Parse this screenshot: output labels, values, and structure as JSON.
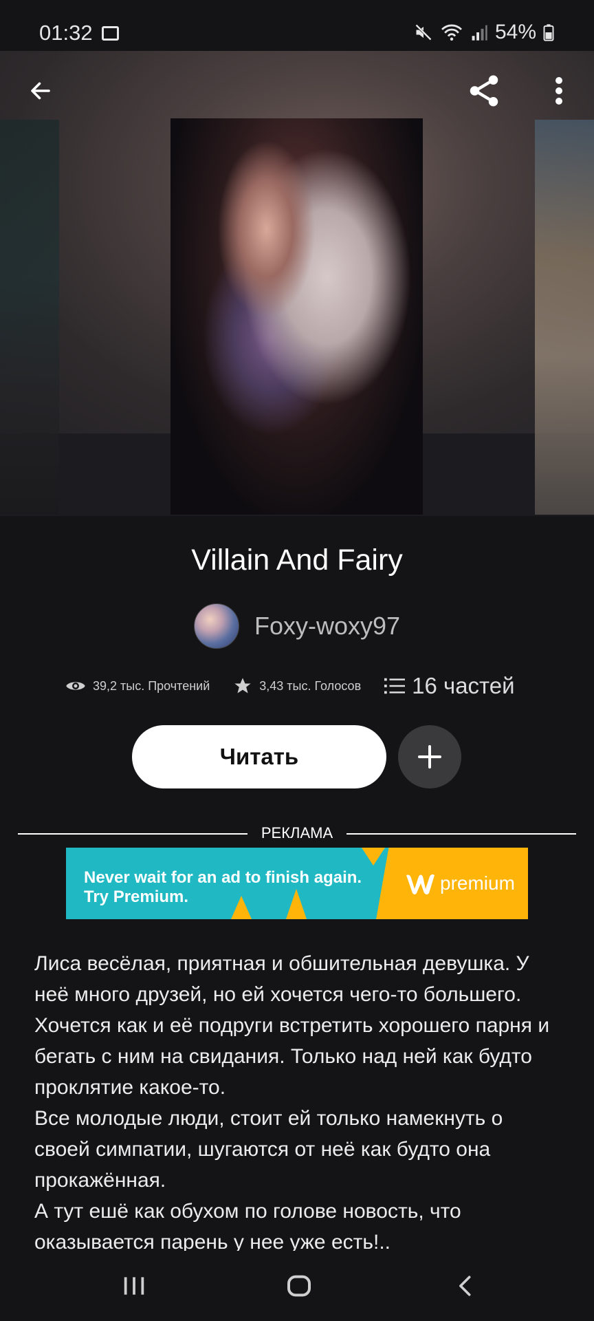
{
  "status_bar": {
    "time": "01:32",
    "battery": "54%",
    "icons": [
      "image-icon",
      "mute-icon",
      "wifi-icon",
      "signal-icon",
      "battery-icon"
    ]
  },
  "toolbar": {
    "back_icon": "back-arrow-icon",
    "share_icon": "share-icon",
    "more_icon": "more-vertical-icon"
  },
  "story": {
    "title": "Villain And Fairy",
    "author": "Foxy-woxy97",
    "stats": {
      "reads": "39,2 тыс. Прочтений",
      "votes": "3,43 тыс. Голосов",
      "parts": "16 частей"
    },
    "read_button": "Читать",
    "add_icon": "plus-icon"
  },
  "ad": {
    "label": "РЕКЛАМА",
    "line1": "Never wait for an ad to finish again.",
    "line2": "Try Premium.",
    "brand": "premium"
  },
  "description": [
    "Лиса весёлая, приятная и обшительная девушка. У неё много друзей, но ей хочется чего-то большего. Хочется как и её подруги встретить хорошего парня и бегать с ним на свидания. Только над ней как будто проклятие какое-то.",
    "Все молодые люди, стоит ей только намекнуть о своей симпатии, шугаются от неё как будто она прокажённая.",
    "А тут ешё как обухом по голове новость, что оказывается парень у нее уже есть!.."
  ],
  "nav": {
    "recents_icon": "recents-icon",
    "home_icon": "home-icon",
    "back_icon": "nav-back-icon"
  },
  "colors": {
    "background": "#141316",
    "ad_teal": "#20b9c3",
    "ad_orange": "#ffb40a"
  }
}
